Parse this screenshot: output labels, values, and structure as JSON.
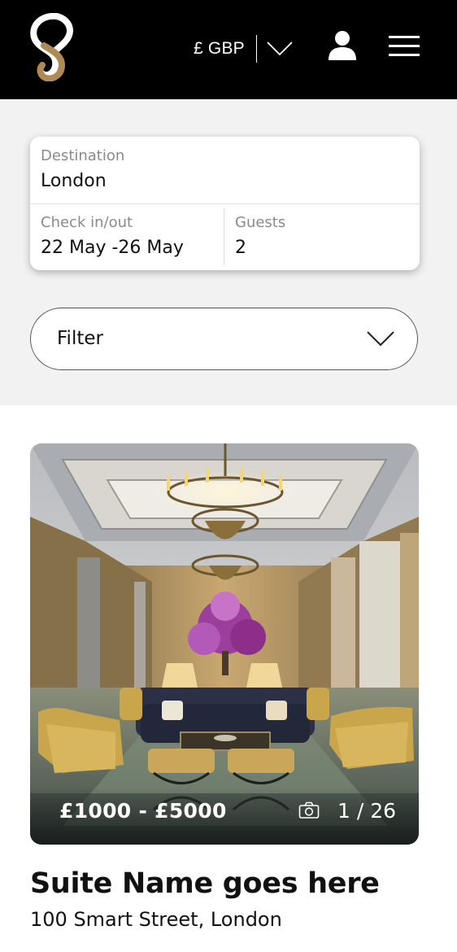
{
  "header": {
    "logo_icon": "brand-s-logo-icon",
    "currency_label": "£ GBP",
    "currency_dropdown_icon": "chevron-down-icon",
    "account_icon": "user-icon",
    "menu_icon": "hamburger-menu-icon",
    "background_color": "#000000",
    "brand_accent_color": "#b08a55"
  },
  "search": {
    "destination": {
      "label": "Destination",
      "value": "London"
    },
    "dates": {
      "label": "Check in/out",
      "value": "22 May -26 May"
    },
    "guests": {
      "label": "Guests",
      "value": "2"
    }
  },
  "filter": {
    "label": "Filter",
    "icon": "chevron-down-icon"
  },
  "listing": {
    "price_range": "£1000 - £5000",
    "photo_count_icon": "camera-icon",
    "photo_count": "1 / 26",
    "title": "Suite Name goes here",
    "address": "100 Smart Street, London"
  }
}
